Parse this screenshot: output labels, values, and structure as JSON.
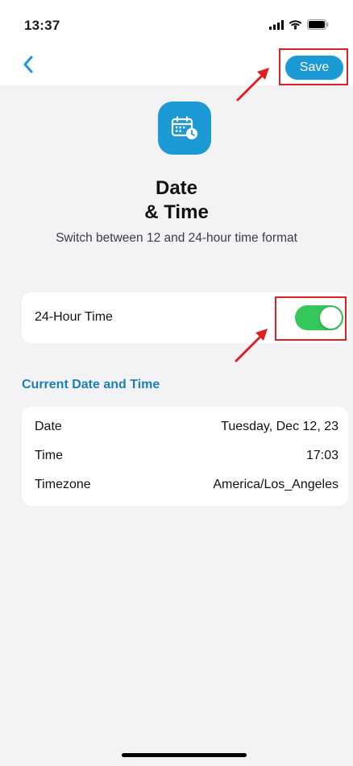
{
  "status_bar": {
    "time": "13:37",
    "icons": [
      "signal-icon",
      "wifi-icon",
      "battery-icon"
    ]
  },
  "nav": {
    "back_icon": "chevron-left-icon",
    "save_label": "Save"
  },
  "header": {
    "icon": "calendar-clock-icon",
    "title_line1": "Date",
    "title_line2": "& Time",
    "subtitle": "Switch between 12 and 24-hour time format"
  },
  "setting": {
    "label": "24-Hour Time",
    "enabled": true
  },
  "section": {
    "title": "Current Date and Time"
  },
  "info": {
    "rows": [
      {
        "label": "Date",
        "value": "Tuesday, Dec 12, 23"
      },
      {
        "label": "Time",
        "value": "17:03"
      },
      {
        "label": "Timezone",
        "value": "America/Los_Angeles"
      }
    ]
  },
  "colors": {
    "accent": "#1b9ad6",
    "section_title": "#1b7fb6",
    "toggle_on": "#34c759",
    "annotation": "#e02020",
    "background": "#f3f3f5"
  }
}
